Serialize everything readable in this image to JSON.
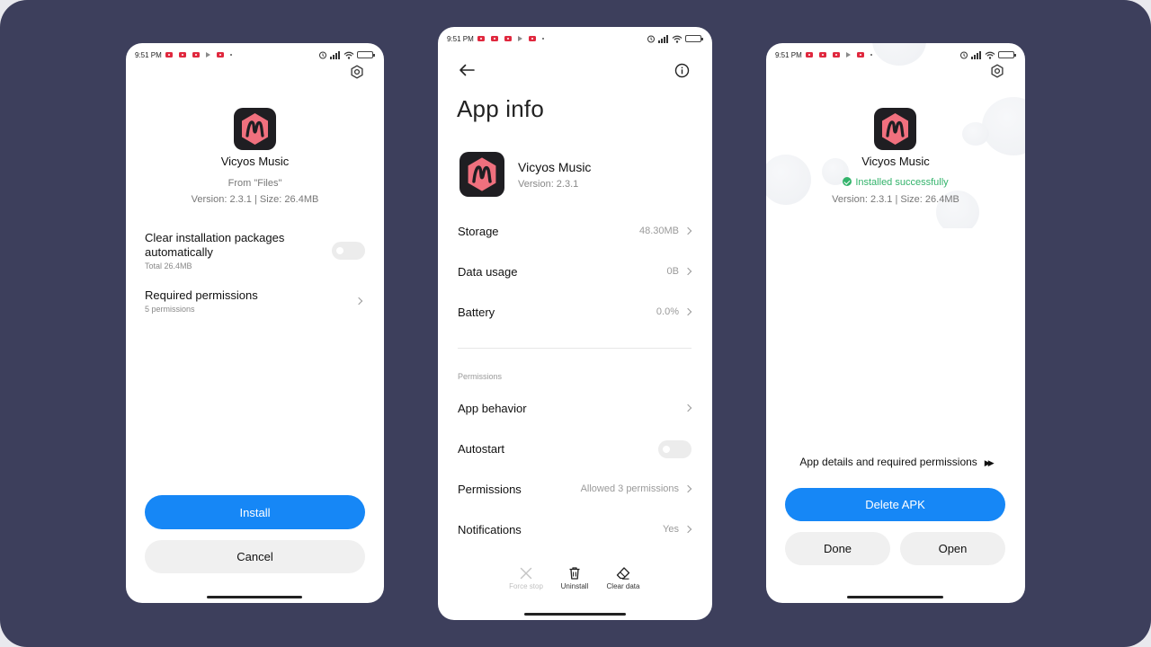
{
  "status": {
    "time": "9:51 PM"
  },
  "app": {
    "name": "Vicyos Music",
    "icon_letter": "M"
  },
  "installer": {
    "from": "From \"Files\"",
    "version_size": "Version: 2.3.1 | Size: 26.4MB",
    "clear_packages": {
      "title": "Clear installation packages automatically",
      "subtitle": "Total 26.4MB",
      "enabled": false
    },
    "permissions": {
      "title": "Required permissions",
      "subtitle": "5 permissions"
    },
    "install_label": "Install",
    "cancel_label": "Cancel"
  },
  "app_info": {
    "title": "App info",
    "version": "Version: 2.3.1",
    "storage": {
      "label": "Storage",
      "value": "48.30MB"
    },
    "data_usage": {
      "label": "Data usage",
      "value": "0B"
    },
    "battery": {
      "label": "Battery",
      "value": "0.0%"
    },
    "section_permissions": "Permissions",
    "app_behavior": {
      "label": "App behavior"
    },
    "autostart": {
      "label": "Autostart",
      "enabled": false
    },
    "permissions": {
      "label": "Permissions",
      "value": "Allowed 3 permissions"
    },
    "notifications": {
      "label": "Notifications",
      "value": "Yes"
    },
    "actions": {
      "force_stop": "Force stop",
      "uninstall": "Uninstall",
      "clear_data": "Clear data"
    }
  },
  "result": {
    "status": "Installed successfully",
    "version_size": "Version: 2.3.1 | Size: 26.4MB",
    "details_link": "App details and required permissions",
    "delete_label": "Delete APK",
    "done_label": "Done",
    "open_label": "Open"
  },
  "colors": {
    "accent": "#1687f6",
    "success": "#33b36b",
    "background": "#3d3f5c",
    "notification": "#e0283e"
  }
}
